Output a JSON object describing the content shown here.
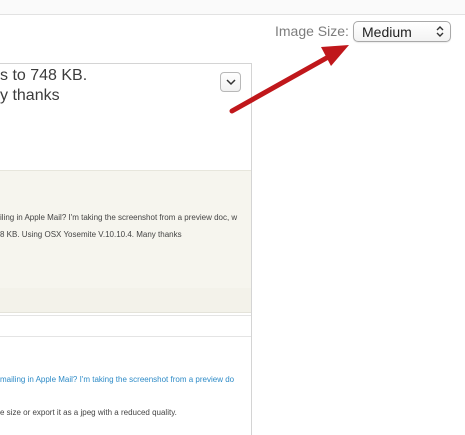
{
  "toolbar": {
    "image_size_label": "Image Size:",
    "image_size_value": "Medium"
  },
  "question": {
    "line1": "s to 748 KB.",
    "line2": "y thanks"
  },
  "body_text": {
    "line1": "iling in Apple Mail? I'm taking the screenshot from a preview doc, w",
    "line2": "8 KB. Using OSX Yosemite V.10.10.4. Many thanks"
  },
  "reply": {
    "link_text": "mailing in Apple Mail? I'm taking the screenshot from a preview do",
    "answer_text": "e size or export it as a jpeg with a reduced quality."
  },
  "colors": {
    "arrow": "#c0171b",
    "link": "#2e8bc7"
  }
}
